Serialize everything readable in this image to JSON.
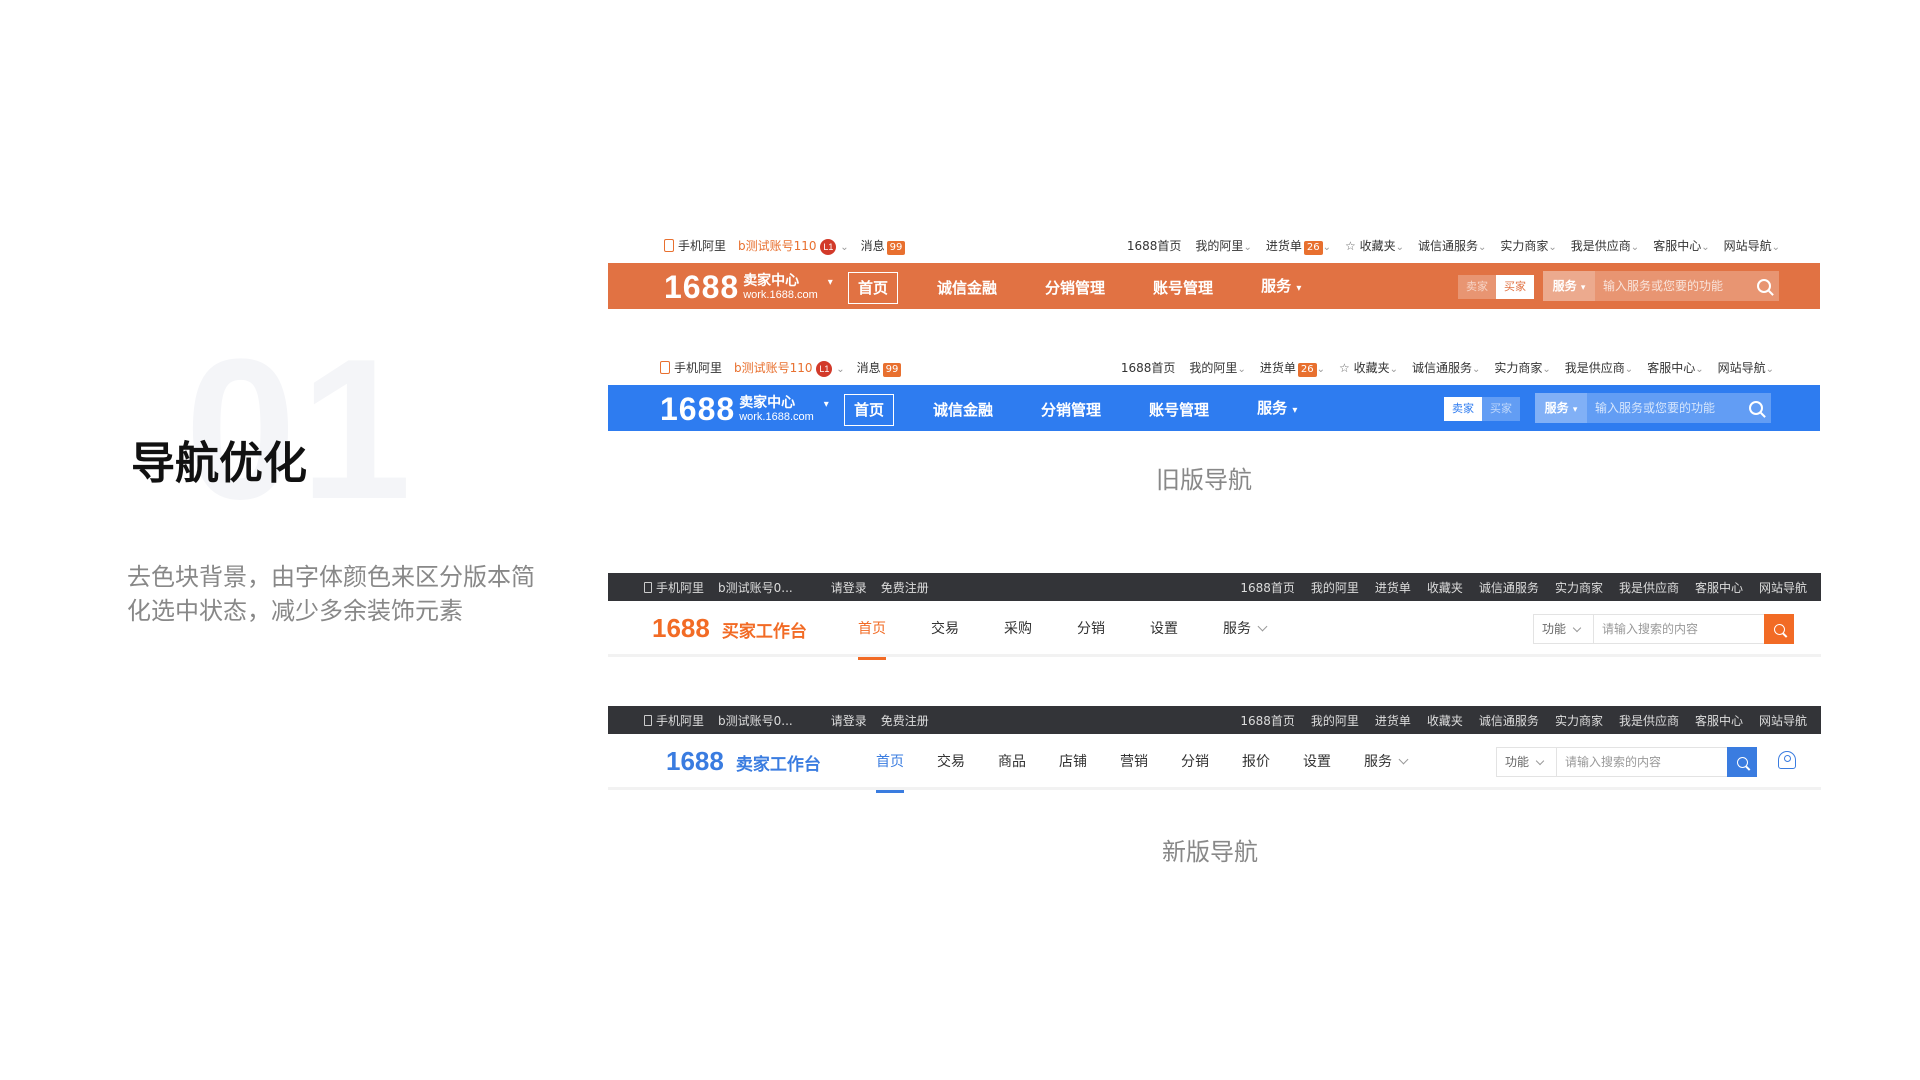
{
  "section": {
    "number": "01",
    "title": "导航优化",
    "description": "去色块背景，由字体颜色来区分版本简化选中状态，减少多余装饰元素"
  },
  "colors": {
    "old_orange": "#e17243",
    "old_blue": "#2e7cf0",
    "new_orange": "#f26b25",
    "new_blue": "#3a7ce0",
    "new_topbar": "#333438"
  },
  "old_nav": {
    "topbar": {
      "phone": "手机阿里",
      "account": "b测试账号110",
      "level": "L1",
      "messages": "消息",
      "messages_count": "99",
      "links": [
        "1688首页",
        "我的阿里",
        "进货单",
        "收藏夹",
        "诚信通服务",
        "实力商家",
        "我是供应商",
        "客服中心",
        "网站导航"
      ],
      "cart_count": "26"
    },
    "logo": {
      "number": "1688",
      "title": "卖家中心",
      "url": "work.1688.com"
    },
    "menu": [
      "首页",
      "诚信金融",
      "分销管理",
      "账号管理",
      "服务"
    ],
    "toggle": [
      "卖家",
      "买家"
    ],
    "search": {
      "service": "服务",
      "placeholder": "输入服务或您要的功能"
    },
    "caption": "旧版导航"
  },
  "new_nav": {
    "topbar": {
      "phone": "手机阿里",
      "account": "b测试账号0...",
      "login": "请登录",
      "register": "免费注册",
      "links": [
        "1688首页",
        "我的阿里",
        "进货单",
        "收藏夹",
        "诚信通服务",
        "实力商家",
        "我是供应商",
        "客服中心",
        "网站导航"
      ]
    },
    "buyer": {
      "logo_number": "1688",
      "logo_title": "买家工作台",
      "menu": [
        "首页",
        "交易",
        "采购",
        "分销",
        "设置",
        "服务"
      ]
    },
    "seller": {
      "logo_number": "1688",
      "logo_title": "卖家工作台",
      "menu": [
        "首页",
        "交易",
        "商品",
        "店铺",
        "营销",
        "分销",
        "报价",
        "设置",
        "服务"
      ]
    },
    "search": {
      "function_label": "功能",
      "placeholder": "请输入搜索的内容"
    },
    "caption": "新版导航"
  }
}
